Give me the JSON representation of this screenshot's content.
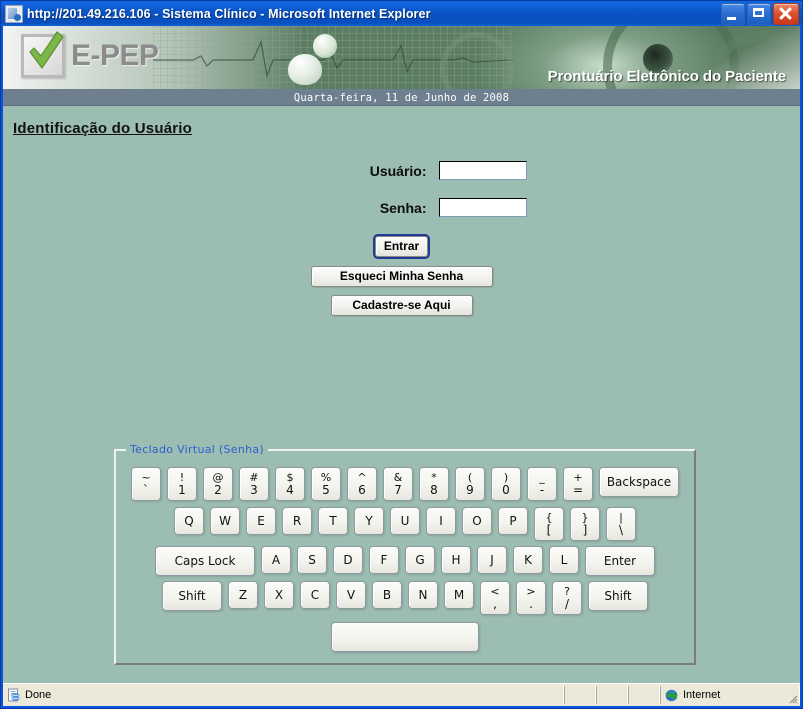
{
  "window": {
    "title": "http://201.49.216.106 - Sistema Clínico - Microsoft Internet Explorer",
    "icon": "ie-document-icon",
    "minimize_label": "Minimize",
    "maximize_label": "Maximize",
    "close_label": "Close"
  },
  "banner": {
    "logo_text": "E-PEP",
    "tagline": "Prontuário Eletrônico do Paciente",
    "date": "Quarta-feira, 11 de Junho de 2008",
    "colors": {
      "page_background": "#9cbdb1",
      "date_bar": "#6e7f8f",
      "logo_gray": "#8c8c8c",
      "check_green": "#7ab648",
      "legend_blue": "#2f5fd0"
    }
  },
  "page": {
    "title": "Identificação do Usuário"
  },
  "form": {
    "fields": [
      {
        "label": "Usuário:",
        "value": "",
        "placeholder": ""
      },
      {
        "label": "Senha:",
        "value": "",
        "placeholder": ""
      }
    ],
    "buttons": [
      {
        "label": "Entrar",
        "default": true
      },
      {
        "label": "Esqueci Minha Senha",
        "default": false
      },
      {
        "label": "Cadastre-se Aqui",
        "default": false
      }
    ]
  },
  "keyboard": {
    "legend": "Teclado Virtual (Senha)",
    "rows": [
      {
        "keys": [
          {
            "type": "dual",
            "top": "~",
            "bottom": "`"
          },
          {
            "type": "dual",
            "top": "!",
            "bottom": "1"
          },
          {
            "type": "dual",
            "top": "@",
            "bottom": "2"
          },
          {
            "type": "dual",
            "top": "#",
            "bottom": "3"
          },
          {
            "type": "dual",
            "top": "$",
            "bottom": "4"
          },
          {
            "type": "dual",
            "top": "%",
            "bottom": "5"
          },
          {
            "type": "dual",
            "top": "^",
            "bottom": "6"
          },
          {
            "type": "dual",
            "top": "&",
            "bottom": "7"
          },
          {
            "type": "dual",
            "top": "*",
            "bottom": "8"
          },
          {
            "type": "dual",
            "top": "(",
            "bottom": "9"
          },
          {
            "type": "dual",
            "top": ")",
            "bottom": "0"
          },
          {
            "type": "dual",
            "top": "_",
            "bottom": "-"
          },
          {
            "type": "dual",
            "top": "+",
            "bottom": "="
          },
          {
            "type": "wide-bs",
            "label": "Backspace"
          }
        ]
      },
      {
        "keys": [
          {
            "type": "single",
            "label": "Q"
          },
          {
            "type": "single",
            "label": "W"
          },
          {
            "type": "single",
            "label": "E"
          },
          {
            "type": "single",
            "label": "R"
          },
          {
            "type": "single",
            "label": "T"
          },
          {
            "type": "single",
            "label": "Y"
          },
          {
            "type": "single",
            "label": "U"
          },
          {
            "type": "single",
            "label": "I"
          },
          {
            "type": "single",
            "label": "O"
          },
          {
            "type": "single",
            "label": "P"
          },
          {
            "type": "dual",
            "top": "{",
            "bottom": "["
          },
          {
            "type": "dual",
            "top": "}",
            "bottom": "]"
          },
          {
            "type": "dual",
            "top": "|",
            "bottom": "\\"
          }
        ]
      },
      {
        "keys": [
          {
            "type": "wide-caps",
            "label": "Caps Lock"
          },
          {
            "type": "single",
            "label": "A"
          },
          {
            "type": "single",
            "label": "S"
          },
          {
            "type": "single",
            "label": "D"
          },
          {
            "type": "single",
            "label": "F"
          },
          {
            "type": "single",
            "label": "G"
          },
          {
            "type": "single",
            "label": "H"
          },
          {
            "type": "single",
            "label": "J"
          },
          {
            "type": "single",
            "label": "K"
          },
          {
            "type": "single",
            "label": "L"
          },
          {
            "type": "wide-enter",
            "label": "Enter"
          }
        ]
      },
      {
        "keys": [
          {
            "type": "wide-shift",
            "label": "Shift"
          },
          {
            "type": "single",
            "label": "Z"
          },
          {
            "type": "single",
            "label": "X"
          },
          {
            "type": "single",
            "label": "C"
          },
          {
            "type": "single",
            "label": "V"
          },
          {
            "type": "single",
            "label": "B"
          },
          {
            "type": "single",
            "label": "N"
          },
          {
            "type": "single",
            "label": "M"
          },
          {
            "type": "dual",
            "top": "<",
            "bottom": ","
          },
          {
            "type": "dual",
            "top": ">",
            "bottom": "."
          },
          {
            "type": "dual",
            "top": "?",
            "bottom": "/"
          },
          {
            "type": "wide-shift",
            "label": "Shift"
          }
        ]
      },
      {
        "keys": [
          {
            "type": "space",
            "label": ""
          }
        ]
      }
    ]
  },
  "statusbar": {
    "message": "Done",
    "zone": "Internet",
    "message_icon": "ie-page-icon",
    "zone_icon": "globe-icon"
  }
}
